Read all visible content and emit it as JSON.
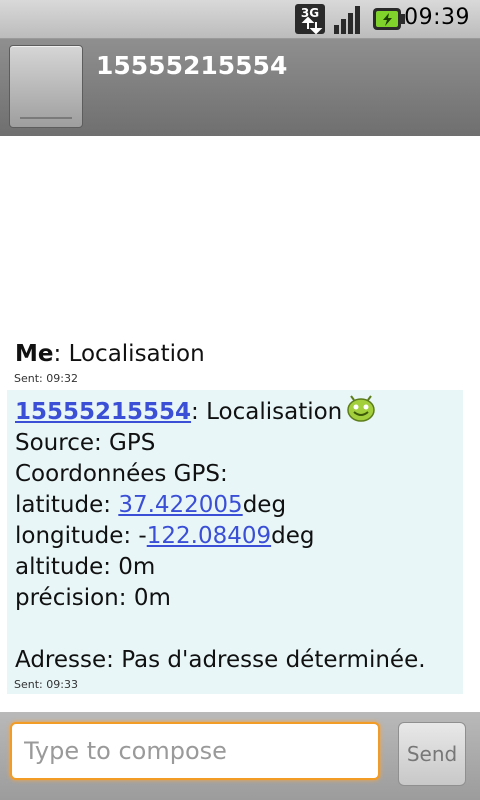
{
  "status_bar": {
    "time": "09:39",
    "network_label": "3G",
    "icons": [
      "network-3g-icon",
      "signal-strength-icon",
      "battery-charging-icon"
    ]
  },
  "header": {
    "contact_number": "15555215554"
  },
  "messages": [
    {
      "sender": "Me",
      "text": "Localisation",
      "sent": "Sent: 09:32"
    },
    {
      "sender": "15555215554",
      "text": "Localisation",
      "source_line": " Source: GPS",
      "coords_heading": "Coordonnées GPS:",
      "latitude_label": "latitude: ",
      "latitude_value": "37.422005",
      "longitude_label": "longitude: -",
      "longitude_value": "122.08409",
      "unit": "deg",
      "altitude_line": "altitude: 0m",
      "precision_line": "précision: 0m",
      "address_line": "Adresse: Pas d'adresse déterminée.",
      "sent": "Sent: 09:33"
    }
  ],
  "compose": {
    "placeholder": "Type to compose",
    "send_label": "Send"
  },
  "colors": {
    "link": "#3a4fd6",
    "focus_border": "#f29b25",
    "incoming_bg": "#e8f6f8"
  }
}
